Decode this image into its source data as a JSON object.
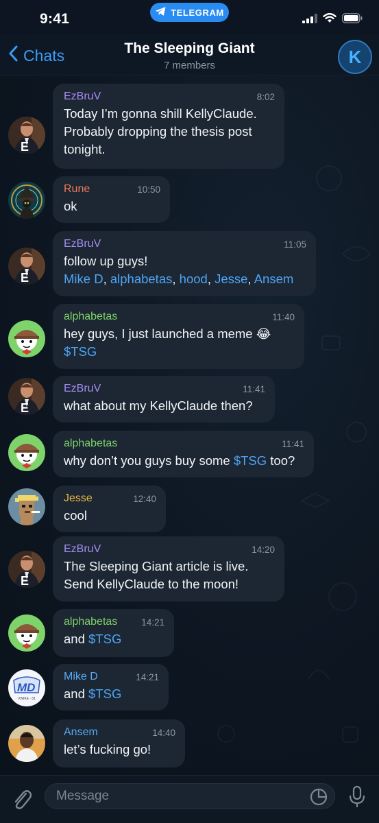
{
  "status_bar": {
    "time": "9:41",
    "pill_label": "TELEGRAM"
  },
  "header": {
    "back_label": "Chats",
    "title": "The Sleeping Giant",
    "subtitle": "7 members",
    "avatar_letter": "K"
  },
  "colors": {
    "accent": "#3d9bf5",
    "bubble": "#1c2733",
    "background": "#0c1521",
    "name_ezbruv": "#a88cf2",
    "name_rune": "#ee7a57",
    "name_alphabetas": "#7ed36a",
    "name_jesse": "#e8b43f",
    "name_miked": "#5aa9f2",
    "name_ansem": "#5aa9f2"
  },
  "messages": [
    {
      "sender": "EzBruV",
      "time": "8:02",
      "lines": [
        "Today I’m gonna shill KellyClaude.",
        "Probably dropping the thesis post",
        "tonight."
      ]
    },
    {
      "sender": "Rune",
      "time": "10:50",
      "lines": [
        "ok"
      ]
    },
    {
      "sender": "EzBruV",
      "time": "11:05",
      "lines": [
        "follow up guys!"
      ],
      "mentions": [
        "Mike D",
        "alphabetas",
        "hood",
        "Jesse",
        "Ansem"
      ],
      "mention_sep": ", "
    },
    {
      "sender": "alphabetas",
      "time": "11:40",
      "lines": [
        "hey guys, I just launched a meme 😂"
      ],
      "ticker": "$TSG"
    },
    {
      "sender": "EzBruV",
      "time": "11:41",
      "lines": [
        "what about my KellyClaude then?"
      ]
    },
    {
      "sender": "alphabetas",
      "time": "11:41",
      "pre": "why don’t you guys buy some ",
      "ticker": "$TSG",
      "post": " too?"
    },
    {
      "sender": "Jesse",
      "time": "12:40",
      "lines": [
        "cool"
      ]
    },
    {
      "sender": "EzBruV",
      "time": "14:20",
      "lines": [
        "The Sleeping Giant article is live.",
        "Send KellyClaude to the moon!"
      ]
    },
    {
      "sender": "alphabetas",
      "time": "14:21",
      "pre": "and ",
      "ticker": "$TSG"
    },
    {
      "sender": "Mike D",
      "time": "14:21",
      "pre": "and ",
      "ticker": "$TSG"
    },
    {
      "sender": "Ansem",
      "time": "14:40",
      "lines": [
        "let’s fucking go!"
      ]
    }
  ],
  "avatars": {
    "ezbruv_letter": "E",
    "miked_text": "MD",
    "miked_subtext": "KNIKE · 01"
  },
  "composer": {
    "placeholder": "Message"
  },
  "icons": [
    "telegram-plane-icon",
    "signal-icon",
    "wifi-icon",
    "battery-icon",
    "chevron-left-icon",
    "paperclip-icon",
    "sticker-icon",
    "microphone-icon"
  ]
}
